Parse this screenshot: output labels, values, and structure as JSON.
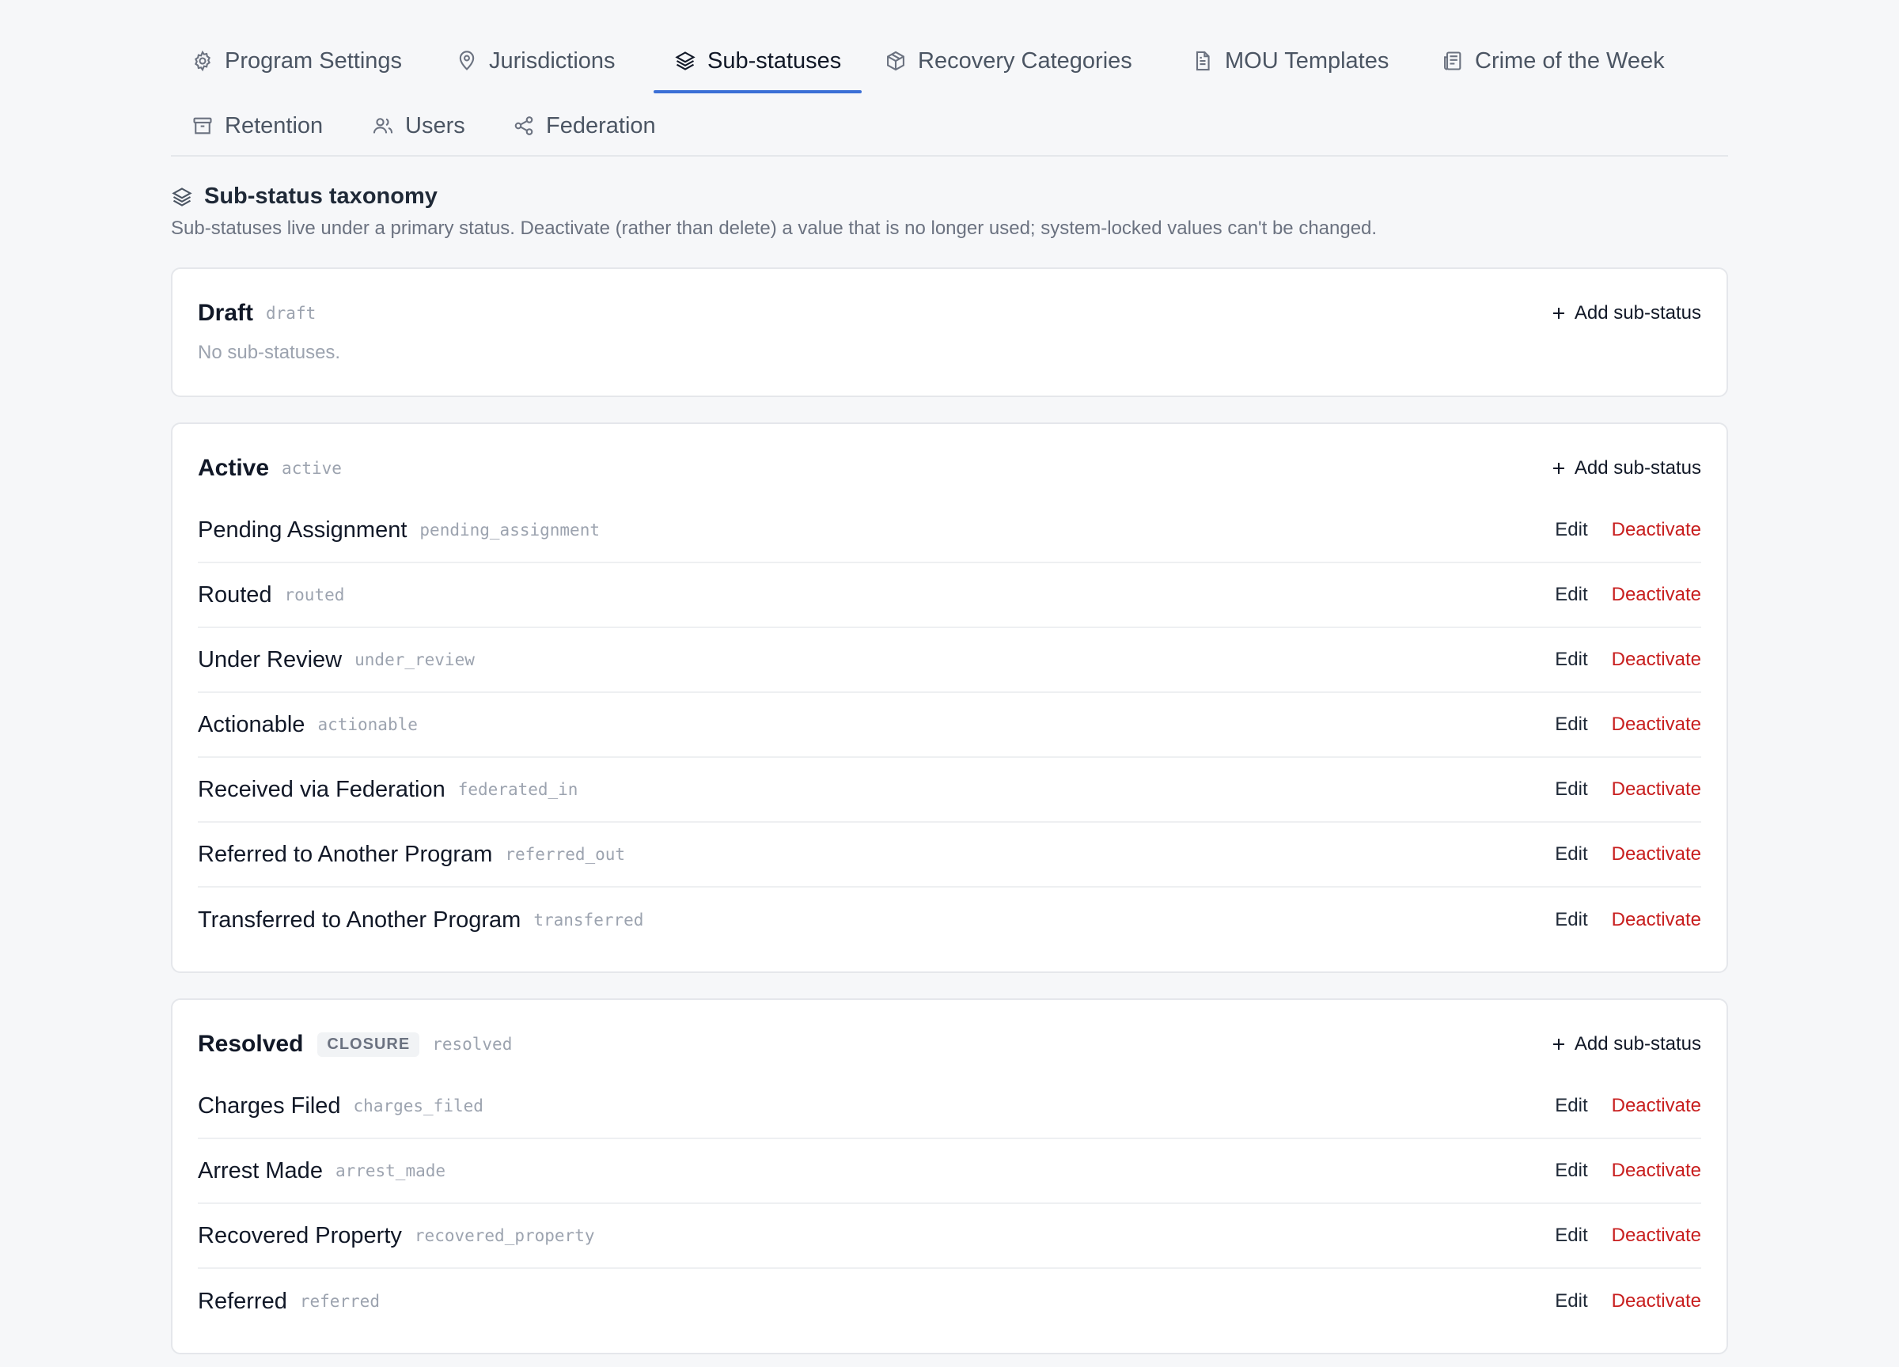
{
  "tabs": [
    {
      "label": "Program Settings",
      "icon": "gear-icon"
    },
    {
      "label": "Jurisdictions",
      "icon": "map-pin-icon"
    },
    {
      "label": "Sub-statuses",
      "icon": "layers-icon",
      "active": true
    },
    {
      "label": "Recovery Categories",
      "icon": "package-icon"
    },
    {
      "label": "MOU Templates",
      "icon": "file-text-icon"
    },
    {
      "label": "Crime of the Week",
      "icon": "newspaper-icon"
    },
    {
      "label": "Retention",
      "icon": "archive-icon"
    },
    {
      "label": "Users",
      "icon": "users-icon"
    },
    {
      "label": "Federation",
      "icon": "share-icon"
    }
  ],
  "section": {
    "title": "Sub-status taxonomy",
    "description": "Sub-statuses live under a primary status. Deactivate (rather than delete) a value that is no longer used; system-locked values can't be changed."
  },
  "labels": {
    "add": "Add sub-status",
    "edit": "Edit",
    "deactivate": "Deactivate",
    "empty": "No sub-statuses."
  },
  "groups": [
    {
      "name": "Draft",
      "code": "draft",
      "badge": "",
      "items": []
    },
    {
      "name": "Active",
      "code": "active",
      "badge": "",
      "items": [
        {
          "name": "Pending Assignment",
          "code": "pending_assignment"
        },
        {
          "name": "Routed",
          "code": "routed"
        },
        {
          "name": "Under Review",
          "code": "under_review"
        },
        {
          "name": "Actionable",
          "code": "actionable"
        },
        {
          "name": "Received via Federation",
          "code": "federated_in"
        },
        {
          "name": "Referred to Another Program",
          "code": "referred_out"
        },
        {
          "name": "Transferred to Another Program",
          "code": "transferred"
        }
      ]
    },
    {
      "name": "Resolved",
      "code": "resolved",
      "badge": "CLOSURE",
      "items": [
        {
          "name": "Charges Filed",
          "code": "charges_filed"
        },
        {
          "name": "Arrest Made",
          "code": "arrest_made"
        },
        {
          "name": "Recovered Property",
          "code": "recovered_property"
        },
        {
          "name": "Referred",
          "code": "referred"
        }
      ]
    }
  ],
  "colors": {
    "accent": "#3b6fd6",
    "danger": "#c81e1e"
  }
}
